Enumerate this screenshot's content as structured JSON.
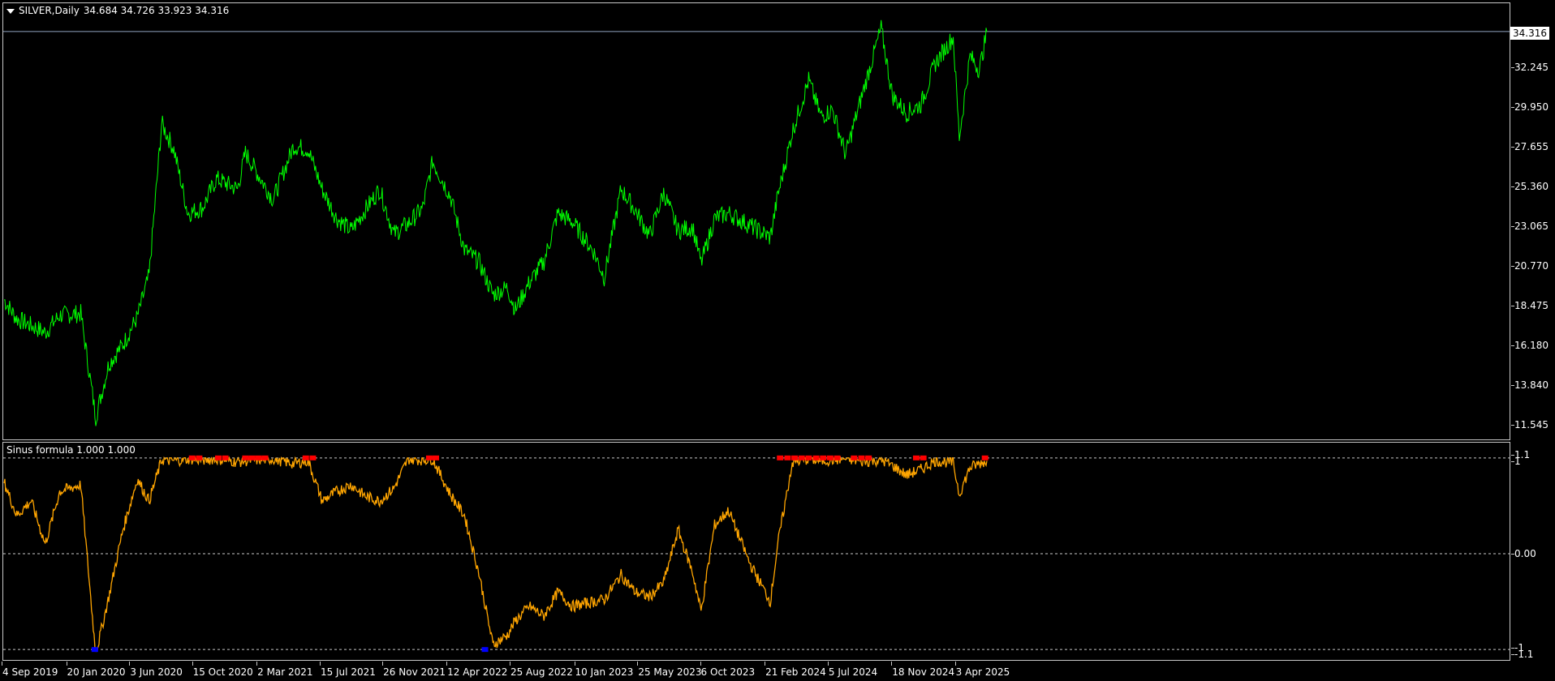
{
  "main_header": {
    "title": "SILVER,Daily",
    "ohlc": "34.684 34.726 33.923 34.316"
  },
  "indicator_header": {
    "title": "Sinus formula 1.000 1.000"
  },
  "price_badge": "34.316",
  "colors": {
    "price_line": "#00ff00",
    "indicator_line": "#ffa500",
    "overbought_marker": "#ff0000",
    "oversold_marker": "#0000ff",
    "background": "#000000",
    "axis_text": "#ffffff"
  },
  "chart_data": [
    {
      "type": "line",
      "title": "SILVER,Daily",
      "ylim": [
        11.0,
        35.2
      ],
      "y_ticks": [
        "32.245",
        "29.950",
        "27.655",
        "25.360",
        "23.065",
        "20.770",
        "18.475",
        "16.180",
        "13.840",
        "11.545"
      ],
      "x_tick_labels": [
        "4 Sep 2019",
        "20 Jan 2020",
        "3 Jun 2020",
        "15 Oct 2020",
        "2 Mar 2021",
        "15 Jul 2021",
        "26 Nov 2021",
        "12 Apr 2022",
        "25 Aug 2022",
        "10 Jan 2023",
        "25 May 2023",
        "6 Oct 2023",
        "21 Feb 2024",
        "5 Jul 2024",
        "18 Nov 2024",
        "3 Apr 2025"
      ],
      "current_price": 34.316,
      "series": [
        {
          "name": "SILVER",
          "x": [
            "2019-09-04",
            "2019-10-01",
            "2019-11-01",
            "2019-12-01",
            "2020-01-01",
            "2020-02-15",
            "2020-03-18",
            "2020-04-15",
            "2020-05-15",
            "2020-06-15",
            "2020-07-10",
            "2020-08-06",
            "2020-09-01",
            "2020-10-01",
            "2020-11-01",
            "2020-12-01",
            "2021-01-15",
            "2021-02-01",
            "2021-03-01",
            "2021-04-01",
            "2021-05-15",
            "2021-06-15",
            "2021-07-15",
            "2021-08-15",
            "2021-09-15",
            "2021-10-15",
            "2021-11-15",
            "2021-12-15",
            "2022-01-15",
            "2022-02-15",
            "2022-03-08",
            "2022-04-15",
            "2022-05-15",
            "2022-06-15",
            "2022-07-15",
            "2022-08-15",
            "2022-09-01",
            "2022-10-01",
            "2022-11-01",
            "2022-12-01",
            "2023-01-01",
            "2023-02-15",
            "2023-03-10",
            "2023-04-15",
            "2023-05-15",
            "2023-06-15",
            "2023-07-15",
            "2023-08-15",
            "2023-09-15",
            "2023-10-03",
            "2023-11-01",
            "2023-12-01",
            "2024-01-15",
            "2024-02-28",
            "2024-03-15",
            "2024-04-15",
            "2024-05-20",
            "2024-06-15",
            "2024-07-10",
            "2024-08-07",
            "2024-09-15",
            "2024-10-22",
            "2024-11-15",
            "2024-12-15",
            "2025-01-15",
            "2025-02-15",
            "2025-03-25",
            "2025-04-07",
            "2025-04-30",
            "2025-05-20",
            "2025-06-05"
          ],
          "values": [
            18.8,
            17.7,
            17.3,
            16.9,
            17.9,
            18.0,
            12.0,
            15.1,
            16.2,
            17.8,
            20.2,
            29.0,
            27.5,
            23.8,
            24.1,
            25.8,
            25.2,
            27.3,
            26.0,
            24.6,
            27.7,
            27.5,
            25.2,
            23.5,
            22.8,
            24.0,
            25.2,
            22.6,
            23.2,
            24.1,
            26.8,
            24.8,
            21.7,
            21.0,
            19.1,
            19.5,
            18.2,
            19.8,
            21.0,
            23.8,
            23.3,
            21.6,
            20.1,
            25.2,
            24.0,
            22.5,
            25.0,
            22.8,
            23.0,
            20.9,
            23.5,
            23.8,
            23.1,
            22.4,
            24.8,
            28.5,
            31.5,
            29.4,
            29.8,
            27.2,
            31.0,
            34.5,
            30.6,
            29.6,
            30.1,
            32.5,
            34.0,
            28.2,
            32.9,
            32.1,
            34.3
          ]
        }
      ]
    },
    {
      "type": "line",
      "title": "Sinus formula 1.000 1.000",
      "ylim": [
        -1.1,
        1.1
      ],
      "y_ticks": [
        "1.1",
        "1",
        "0.00",
        "-1",
        "-1.1"
      ],
      "levels": [
        1,
        0,
        -1
      ],
      "series": [
        {
          "name": "Sinus formula",
          "x": [
            "2019-09-04",
            "2019-10-01",
            "2019-11-01",
            "2019-12-01",
            "2020-01-01",
            "2020-02-15",
            "2020-03-18",
            "2020-04-15",
            "2020-05-15",
            "2020-06-15",
            "2020-07-10",
            "2020-08-06",
            "2020-09-01",
            "2020-10-01",
            "2020-11-01",
            "2020-12-01",
            "2021-01-15",
            "2021-02-01",
            "2021-03-01",
            "2021-04-01",
            "2021-05-15",
            "2021-06-15",
            "2021-07-15",
            "2021-08-15",
            "2021-09-15",
            "2021-10-15",
            "2021-11-15",
            "2021-12-15",
            "2022-01-15",
            "2022-02-15",
            "2022-03-08",
            "2022-04-15",
            "2022-05-15",
            "2022-06-15",
            "2022-07-15",
            "2022-08-15",
            "2022-09-01",
            "2022-10-01",
            "2022-11-01",
            "2022-12-01",
            "2023-01-01",
            "2023-02-15",
            "2023-03-10",
            "2023-04-15",
            "2023-05-15",
            "2023-06-15",
            "2023-07-15",
            "2023-08-15",
            "2023-09-15",
            "2023-10-03",
            "2023-11-01",
            "2023-12-01",
            "2024-01-15",
            "2024-02-28",
            "2024-03-15",
            "2024-04-15",
            "2024-05-20",
            "2024-06-15",
            "2024-07-10",
            "2024-08-07",
            "2024-09-15",
            "2024-10-22",
            "2024-11-15",
            "2024-12-15",
            "2025-01-15",
            "2025-02-15",
            "2025-03-25",
            "2025-04-07",
            "2025-04-30",
            "2025-05-20",
            "2025-06-05"
          ],
          "values": [
            0.75,
            0.4,
            0.55,
            0.1,
            0.65,
            0.72,
            -1.05,
            -0.45,
            0.25,
            0.78,
            0.55,
            0.98,
            0.97,
            0.99,
            0.98,
            0.99,
            0.96,
            0.97,
            0.98,
            0.99,
            0.94,
            0.97,
            0.55,
            0.65,
            0.72,
            0.6,
            0.55,
            0.68,
            0.99,
            0.98,
            0.99,
            0.62,
            0.4,
            -0.2,
            -0.95,
            -0.85,
            -0.7,
            -0.55,
            -0.65,
            -0.4,
            -0.55,
            -0.5,
            -0.48,
            -0.22,
            -0.4,
            -0.45,
            -0.3,
            0.25,
            -0.2,
            -0.6,
            0.3,
            0.45,
            -0.1,
            -0.5,
            0.1,
            0.95,
            0.99,
            0.97,
            0.98,
            0.99,
            0.96,
            0.98,
            0.92,
            0.82,
            0.88,
            0.97,
            0.95,
            0.62,
            0.9,
            0.94,
            0.97
          ]
        }
      ],
      "overbought_markers_x": [
        "2020-10-10",
        "2020-10-25",
        "2020-12-05",
        "2020-12-20",
        "2021-02-01",
        "2021-02-15",
        "2021-03-01",
        "2021-03-15",
        "2021-06-10",
        "2021-06-25",
        "2022-03-01",
        "2022-03-15",
        "2024-03-20",
        "2024-04-05",
        "2024-04-20",
        "2024-05-05",
        "2024-05-20",
        "2024-06-05",
        "2024-06-20",
        "2024-07-05",
        "2024-07-20",
        "2024-08-25",
        "2024-09-10",
        "2024-09-25",
        "2025-01-05",
        "2025-01-20",
        "2025-06-01"
      ],
      "oversold_markers_x": [
        "2020-03-16",
        "2022-06-28"
      ]
    }
  ]
}
